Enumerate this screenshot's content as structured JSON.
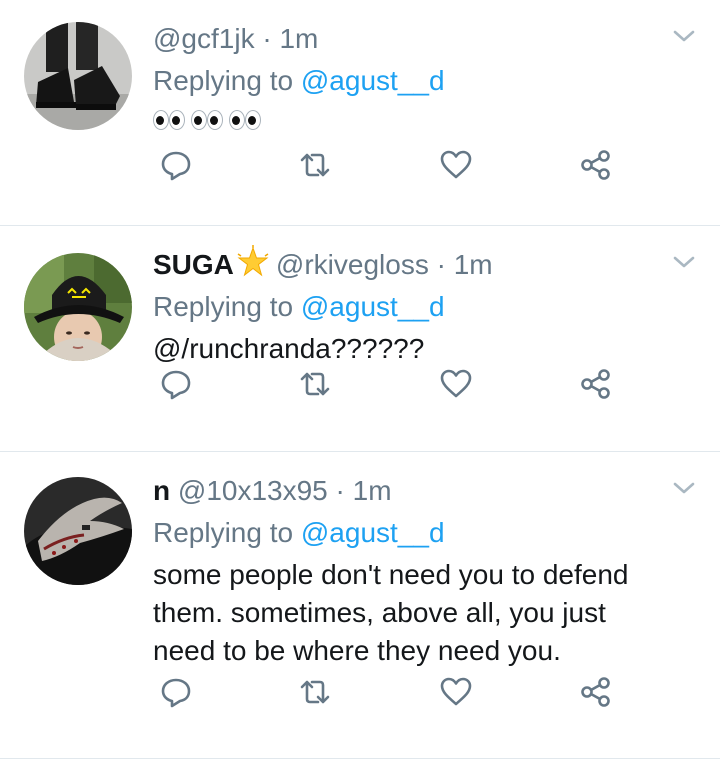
{
  "tweets": [
    {
      "display_name": "",
      "handle": "@gcf1jk",
      "time": "1m",
      "replying_prefix": "Replying to ",
      "replying_to": "@agust__d",
      "text": "👀👀👀",
      "avatar_icon": "boots-photo-avatar"
    },
    {
      "display_name": "SUGA",
      "handle": "@rkivegloss",
      "time": "1m",
      "replying_prefix": "Replying to ",
      "replying_to": "@agust__d",
      "text": "@/runchranda??????",
      "avatar_icon": "person-bucket-hat-avatar"
    },
    {
      "display_name": "n",
      "handle": "@10x13x95",
      "time": "1m",
      "replying_prefix": "Replying to ",
      "replying_to": "@agust__d",
      "text": "some people don't need you to defend them. sometimes, above all, you just need to be where they need you.",
      "avatar_icon": "hand-photo-avatar"
    }
  ],
  "colors": {
    "secondary_text": "#657786",
    "mention": "#1da1f2",
    "divider": "#e1e8ed",
    "icon": "#657786"
  }
}
